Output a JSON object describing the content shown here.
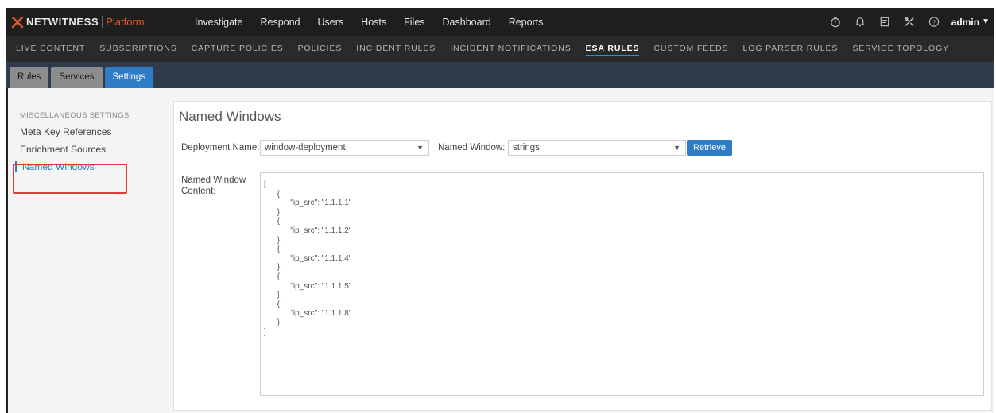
{
  "app": {
    "brand": "NETWITNESS",
    "platform": "Platform"
  },
  "main_nav": [
    "Investigate",
    "Respond",
    "Users",
    "Hosts",
    "Files",
    "Dashboard",
    "Reports"
  ],
  "top_icons": [
    "timer-icon",
    "bell-icon",
    "notepad-icon",
    "tools-icon",
    "help-icon"
  ],
  "user": "admin",
  "sub_nav": {
    "items": [
      "LIVE CONTENT",
      "SUBSCRIPTIONS",
      "CAPTURE POLICIES",
      "POLICIES",
      "INCIDENT RULES",
      "INCIDENT NOTIFICATIONS",
      "ESA RULES",
      "CUSTOM FEEDS",
      "LOG PARSER RULES",
      "SERVICE TOPOLOGY"
    ],
    "active": "ESA RULES"
  },
  "tabs": {
    "items": [
      "Rules",
      "Services",
      "Settings"
    ],
    "active": "Settings"
  },
  "sidebar": {
    "section_title": "MISCELLANEOUS SETTINGS",
    "items": [
      "Meta Key References",
      "Enrichment Sources",
      "Named Windows"
    ],
    "active": "Named Windows"
  },
  "panel": {
    "title": "Named Windows",
    "deployment_label": "Deployment Name:",
    "deployment_value": "window-deployment",
    "window_label": "Named Window:",
    "window_value": "strings",
    "retrieve_label": "Retrieve",
    "content_label_1": "Named Window",
    "content_label_2": "Content:",
    "content": "[\n      {\n            \"ip_src\": \"1.1.1.1\"\n      },\n      {\n            \"ip_src\": \"1.1.1.2\"\n      },\n      {\n            \"ip_src\": \"1.1.1.4\"\n      },\n      {\n            \"ip_src\": \"1.1.1.5\"\n      },\n      {\n            \"ip_src\": \"1.1.1.8\"\n      }\n]"
  },
  "colors": {
    "accent": "#2e7cc6",
    "brand_orange": "#e05a2a",
    "highlight_red": "#e03a3a"
  }
}
